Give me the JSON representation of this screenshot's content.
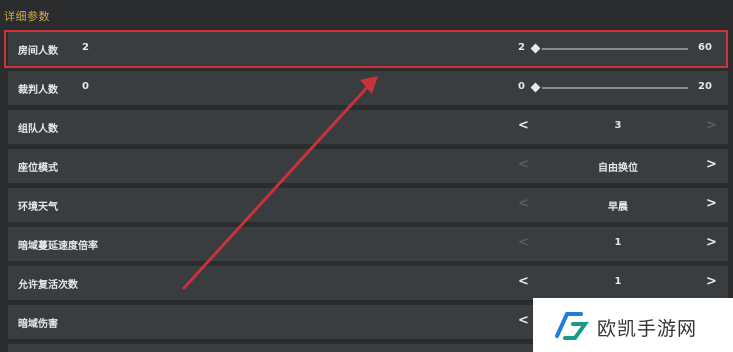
{
  "section": {
    "title": "详细参数"
  },
  "rows": [
    {
      "label": "房间人数",
      "value": "2",
      "slider": {
        "min_label": "2",
        "max_label": "60",
        "fraction": 0
      }
    },
    {
      "label": "裁判人数",
      "value": "0",
      "slider": {
        "min_label": "0",
        "max_label": "20",
        "fraction": 0
      }
    },
    {
      "label": "组队人数",
      "stepper": {
        "value": "3",
        "prev": "<",
        "next": ">"
      }
    },
    {
      "label": "座位模式",
      "stepper": {
        "value": "自由换位",
        "prev": "<",
        "next": ">"
      }
    },
    {
      "label": "环境天气",
      "stepper": {
        "value": "早晨",
        "prev": "<",
        "next": ">"
      }
    },
    {
      "label": "暗域蔓延速度倍率",
      "stepper": {
        "value": "1",
        "prev": "<",
        "next": ">"
      }
    },
    {
      "label": "允许复活次数",
      "stepper": {
        "value": "1",
        "prev": "<",
        "next": ">"
      }
    },
    {
      "label": "暗域伤害",
      "stepper": {
        "value": "",
        "prev": "<",
        "next": ">"
      }
    }
  ],
  "colors": {
    "highlight": "#d0303a",
    "arrow": "#c8323a",
    "section_title": "#d4a84a"
  },
  "watermark": {
    "text": "欧凯手游网",
    "icon": "ok-logo-icon"
  }
}
